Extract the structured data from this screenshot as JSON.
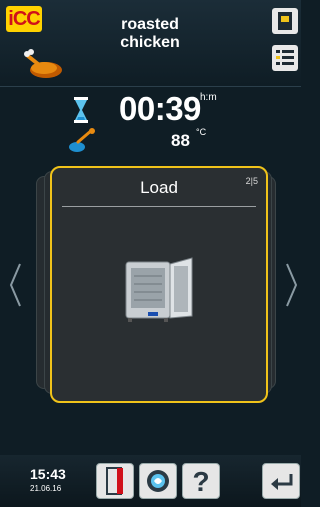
{
  "header": {
    "logo_text": "iCC",
    "title_line1": "roasted",
    "title_line2": "chicken"
  },
  "status": {
    "time_remaining": "00:39",
    "time_unit": "h:m",
    "core_temperature": "88",
    "temperature_unit": "°C"
  },
  "card": {
    "title": "Load",
    "step": "2|5"
  },
  "footer": {
    "clock": "15:43",
    "date": "21.06.16",
    "help_label": "?"
  },
  "colors": {
    "accent_yellow": "#f0c31a",
    "logo_red": "#d0101a",
    "background": "#0f1d25"
  },
  "icons": [
    "icc-logo",
    "chicken-icon",
    "cookbook-icon",
    "checklist-icon",
    "hourglass-icon",
    "core-probe-icon",
    "oven-icon",
    "chevron-left-icon",
    "chevron-right-icon",
    "door-icon",
    "care-cycle-icon",
    "help-icon",
    "back-icon"
  ]
}
